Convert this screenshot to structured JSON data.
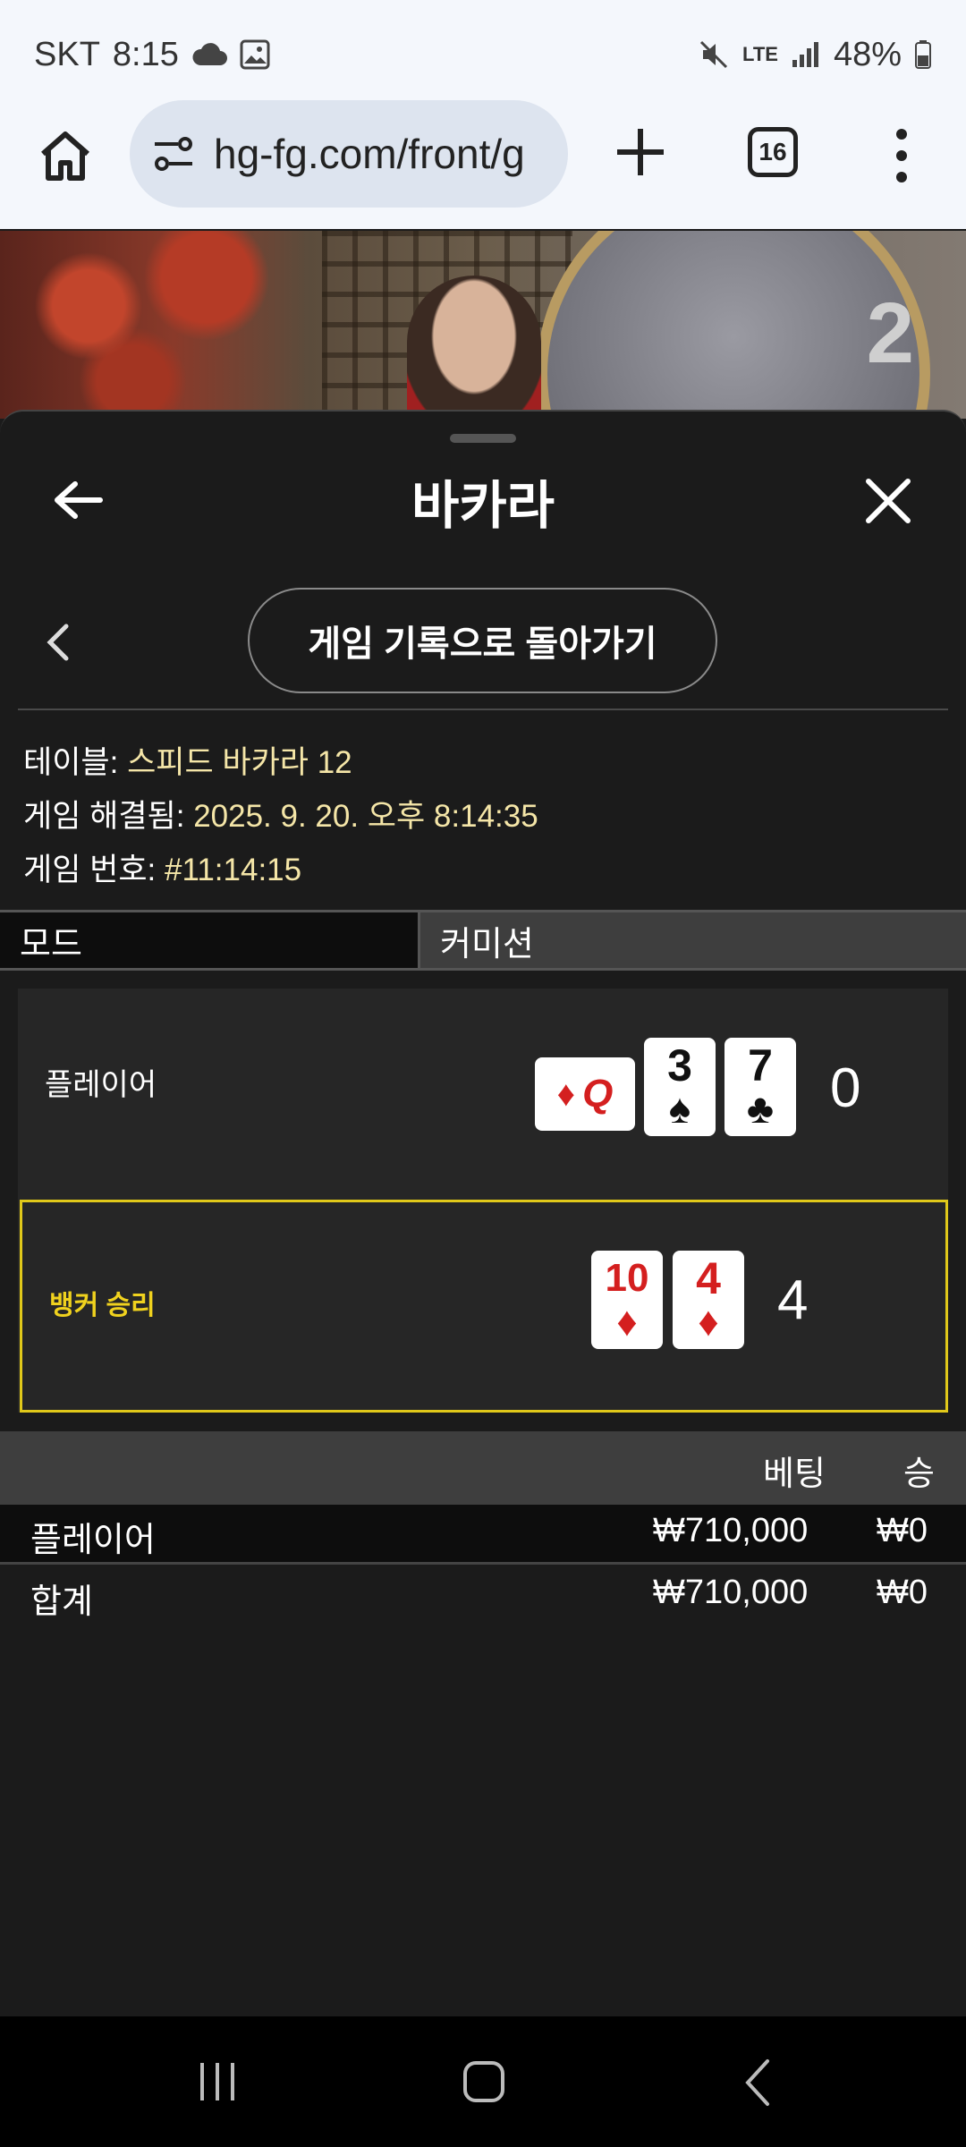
{
  "status_bar": {
    "carrier": "SKT",
    "time": "8:15",
    "network": "LTE",
    "battery": "48%"
  },
  "browser": {
    "url": "hg-fg.com/front/g",
    "tab_count": "16"
  },
  "video": {
    "table_number": "2"
  },
  "header": {
    "title": "바카라"
  },
  "history_button": {
    "label": "게임 기록으로 돌아가기"
  },
  "info": {
    "table_label": "테이블:",
    "table_value": "스피드 바카라 12",
    "resolved_label": "게임 해결됨:",
    "resolved_value": "2025. 9. 20. 오후 8:14:35",
    "game_no_label": "게임 번호:",
    "game_no_value": "#11:14:15"
  },
  "mode": {
    "label": "모드",
    "value": "커미션"
  },
  "result": {
    "player": {
      "label": "플레이어",
      "score": "0",
      "cards": [
        {
          "rank": "3",
          "suit": "♠",
          "color": "black"
        },
        {
          "rank": "7",
          "suit": "♣",
          "color": "black"
        }
      ],
      "side_card": {
        "rank": "Q",
        "suit": "♦",
        "color": "#d41f1f"
      }
    },
    "banker": {
      "label": "뱅커 승리",
      "score": "4",
      "cards": [
        {
          "rank": "10",
          "suit": "♦",
          "color": "red"
        },
        {
          "rank": "4",
          "suit": "♦",
          "color": "red"
        }
      ]
    }
  },
  "bets": {
    "headers": {
      "bet": "베팅",
      "win": "승"
    },
    "rows": [
      {
        "name": "플레이어",
        "bet": "₩710,000",
        "win": "₩0"
      }
    ],
    "total": {
      "name": "합계",
      "bet": "₩710,000",
      "win": "₩0"
    }
  },
  "colors": {
    "accent_gold": "#f0d21e",
    "card_red": "#d41f1f",
    "value_text": "#f5e6a8"
  }
}
